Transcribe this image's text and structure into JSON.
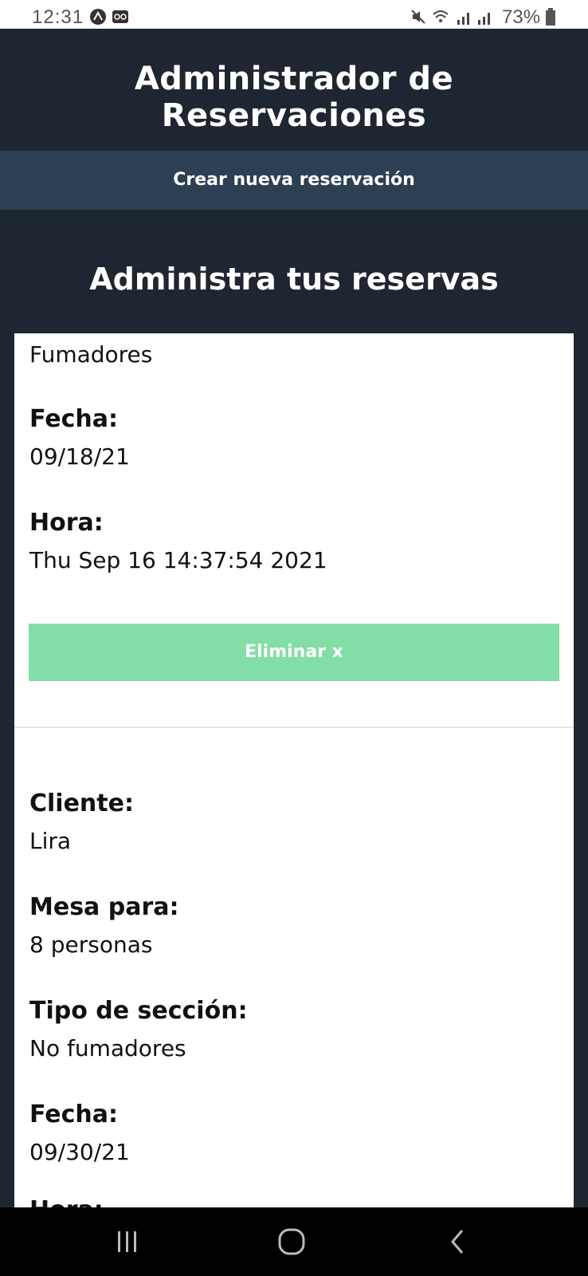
{
  "status_bar": {
    "time": "12:31",
    "battery": "73%",
    "icons": [
      "android-icon",
      "voicemail-icon",
      "mute-icon",
      "wifi-icon",
      "signal-icon",
      "battery-icon"
    ]
  },
  "header": {
    "title": "Administrador de Reservaciones"
  },
  "create_button": {
    "label": "Crear nueva reservación"
  },
  "main": {
    "section_title": "Administra tus reservas"
  },
  "reservations": [
    {
      "section_value": "Fumadores",
      "date_label": "Fecha:",
      "date_value": "09/18/21",
      "time_label": "Hora:",
      "time_value": "Thu Sep 16 14:37:54 2021",
      "delete_label": "Eliminar x"
    },
    {
      "client_label": "Cliente:",
      "client_value": "Lira",
      "table_label": "Mesa para:",
      "table_value": "8 personas",
      "section_label": "Tipo de sección:",
      "section_value": "No fumadores",
      "date_label": "Fecha:",
      "date_value": "09/30/21",
      "time_label": "Hora:"
    }
  ],
  "colors": {
    "background": "#1e2631",
    "create_bar": "#2d3f52",
    "delete_button": "#82dea6",
    "card": "#ffffff"
  },
  "navigation": {
    "icons": [
      "recent-apps-icon",
      "home-icon",
      "back-icon"
    ]
  }
}
